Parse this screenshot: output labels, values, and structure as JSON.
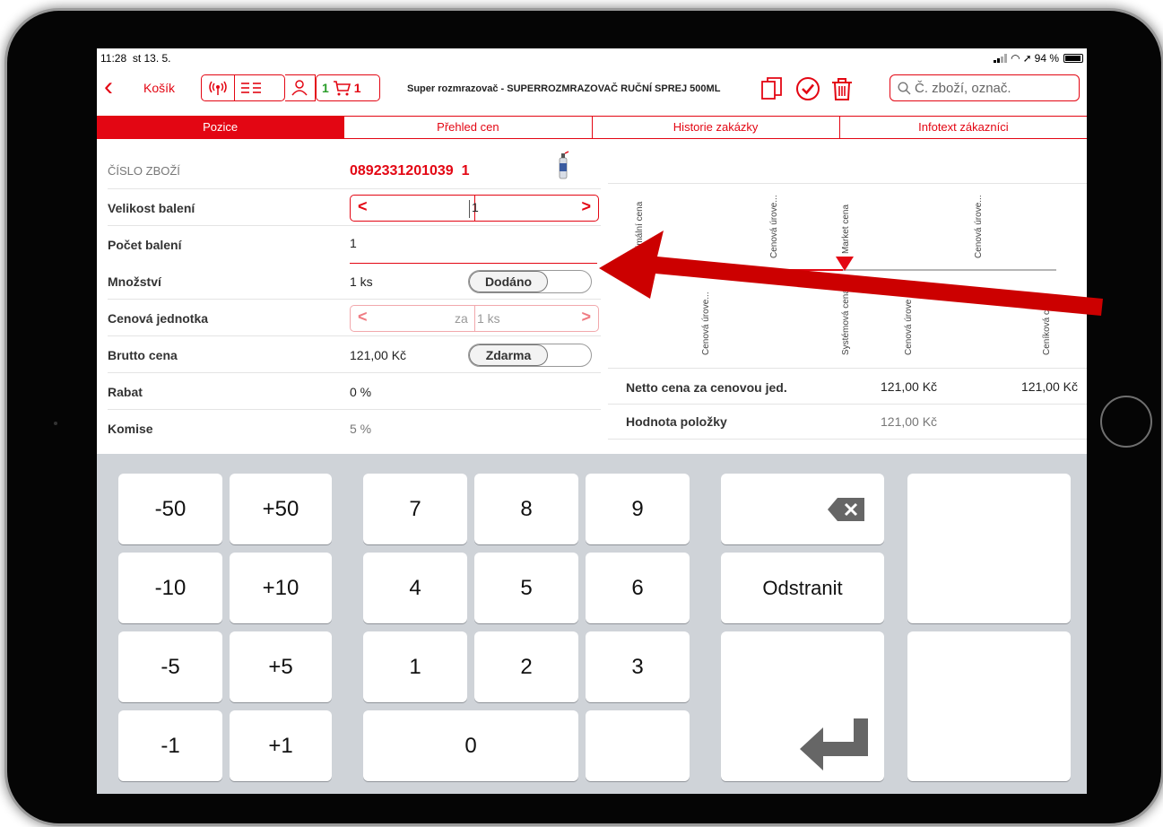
{
  "status_bar": {
    "time": "11:28",
    "date": "st 13. 5.",
    "battery": "94 %"
  },
  "nav": {
    "back_label": "Košík",
    "cart_count_a": "1",
    "cart_count_b": "1",
    "title": "Super rozmrazovač - SUPERROZMRAZOVAČ RUČNÍ SPREJ 500ML",
    "search_placeholder": "Č. zboží, označ."
  },
  "tabs": [
    {
      "label": "Pozice",
      "active": true
    },
    {
      "label": "Přehled cen",
      "active": false
    },
    {
      "label": "Historie zakázky",
      "active": false
    },
    {
      "label": "Infotext zákazníci",
      "active": false
    }
  ],
  "form": {
    "item_number_label": "ČÍSLO ZBOŽÍ",
    "item_number_value": "0892331201039",
    "item_number_suffix": "1",
    "pack_size_label": "Velikost balení",
    "pack_size_value": "1",
    "pack_count_label": "Počet balení",
    "pack_count_value": "1",
    "quantity_label": "Množství",
    "quantity_value": "1 ks",
    "delivered_toggle": "Dodáno",
    "price_unit_label": "Cenová jednotka",
    "price_unit_prefix": "za",
    "price_unit_value": "1 ks",
    "gross_price_label": "Brutto cena",
    "gross_price_value": "121,00 Kč",
    "free_toggle": "Zdarma",
    "discount_label": "Rabat",
    "discount_value": "0 %",
    "commission_label": "Komise",
    "commission_value": "5 %"
  },
  "price_chart": {
    "top_labels": [
      "Minimální cena",
      "Cenová úrove...",
      "Market cena",
      "Cenová úrove..."
    ],
    "bottom_labels": [
      "Cenová úrove...",
      "Systémová cena",
      "Cenová úrove",
      "Ceníková c"
    ]
  },
  "price_table": {
    "net_label": "Netto cena za cenovou jed.",
    "net_value_1": "121,00 Kč",
    "net_value_2": "121,00 Kč",
    "item_value_label": "Hodnota položky",
    "item_value": "121,00 Kč"
  },
  "keypad": {
    "k_m50": "-50",
    "k_p50": "+50",
    "k_m10": "-10",
    "k_p10": "+10",
    "k_m5": "-5",
    "k_p5": "+5",
    "k_m1": "-1",
    "k_p1": "+1",
    "k7": "7",
    "k8": "8",
    "k9": "9",
    "k4": "4",
    "k5": "5",
    "k6": "6",
    "k1": "1",
    "k2": "2",
    "k3": "3",
    "k0": "0",
    "remove": "Odstranit"
  },
  "colors": {
    "accent": "#e30613",
    "annotation_arrow": "#cc0000"
  }
}
